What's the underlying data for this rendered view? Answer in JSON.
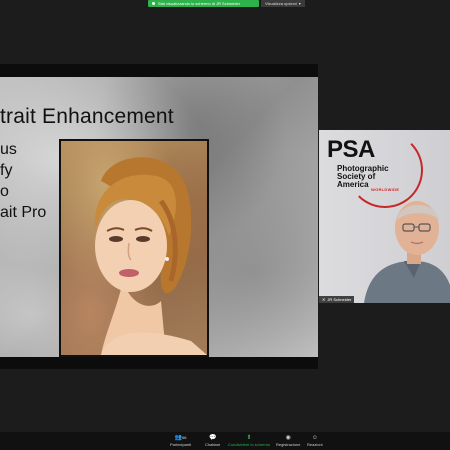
{
  "banner": {
    "sharing_text": "Stai visualizzando lo schermo di JR Schneider",
    "view_options": "Visualizza opzioni"
  },
  "slide": {
    "title": "trait Enhancement",
    "bullets": [
      "us",
      "fy",
      "o",
      "ait Pro"
    ]
  },
  "camera": {
    "logo_main": "PSA",
    "logo_lines": [
      "Photographic",
      "Society of",
      "America"
    ],
    "logo_worldwide": "WORLDWIDE",
    "participant_name": "JR Schneider"
  },
  "toolbar": {
    "participants_label": "Partecipanti",
    "participants_count": "66",
    "chat_label": "Chattare",
    "share_label": "Condividere lo schermo",
    "record_label": "Registrazione",
    "reactions_label": "Reazioni"
  },
  "colors": {
    "share_green": "#2fb24c",
    "psa_red": "#c62828"
  },
  "icons": [
    "dot-icon",
    "chevron-down-icon",
    "participants-icon",
    "chat-icon",
    "share-screen-icon",
    "record-icon",
    "reactions-icon",
    "mic-off-icon"
  ]
}
